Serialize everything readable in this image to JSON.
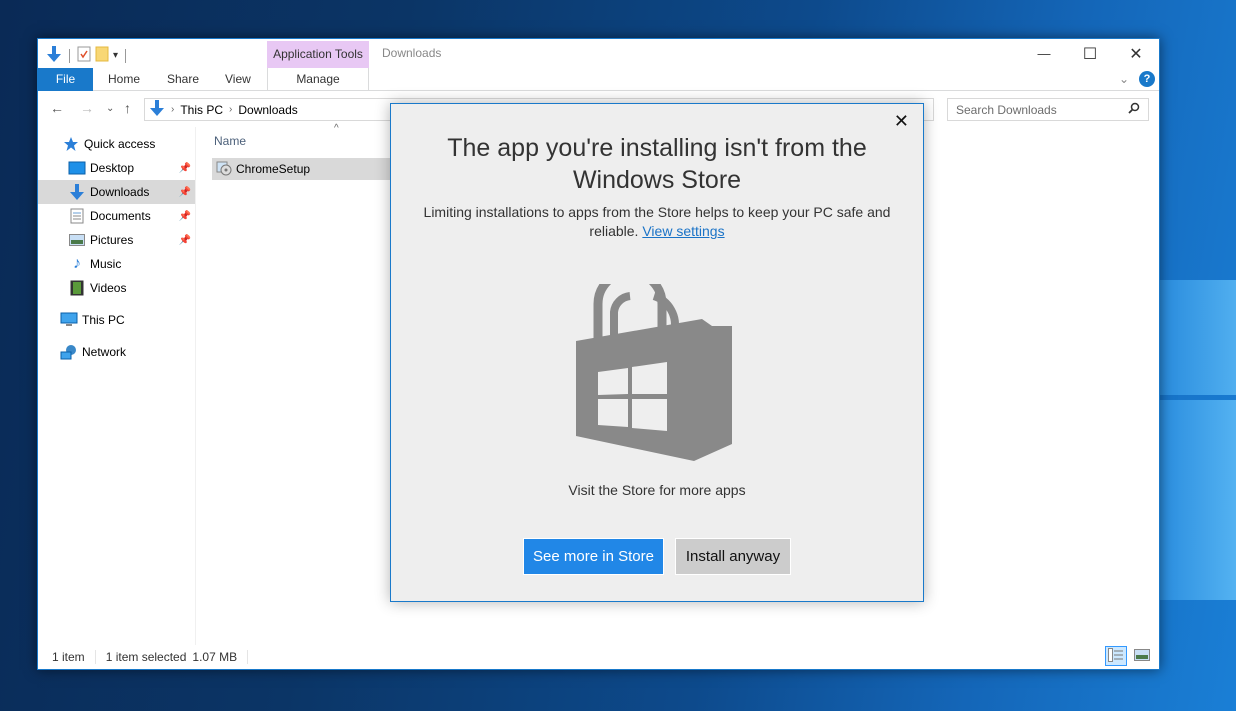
{
  "window": {
    "title": "Downloads",
    "context_tab": "Application Tools",
    "controls": {
      "minimize": "—",
      "maximize": "☐",
      "close": "✕"
    }
  },
  "ribbon": {
    "tabs": [
      {
        "label": "File"
      },
      {
        "label": "Home"
      },
      {
        "label": "Share"
      },
      {
        "label": "View"
      },
      {
        "label": "Manage"
      }
    ],
    "help": "?",
    "collapse": "⌄"
  },
  "navigation": {
    "back": "←",
    "forward": "→",
    "recent": "⌄",
    "up": "↑",
    "breadcrumb": [
      "This PC",
      "Downloads"
    ],
    "separator": "›",
    "search_placeholder": "Search Downloads"
  },
  "sidebar": {
    "items": [
      {
        "label": "Quick access",
        "icon": "star-icon"
      },
      {
        "label": "Desktop",
        "icon": "desktop-icon",
        "pinned": true
      },
      {
        "label": "Downloads",
        "icon": "download-icon",
        "pinned": true,
        "selected": true
      },
      {
        "label": "Documents",
        "icon": "documents-icon",
        "pinned": true
      },
      {
        "label": "Pictures",
        "icon": "pictures-icon",
        "pinned": true
      },
      {
        "label": "Music",
        "icon": "music-icon"
      },
      {
        "label": "Videos",
        "icon": "videos-icon"
      },
      {
        "label": "This PC",
        "icon": "computer-icon"
      },
      {
        "label": "Network",
        "icon": "network-icon"
      }
    ]
  },
  "filelist": {
    "column_name": "Name",
    "sort_indicator": "^",
    "files": [
      {
        "name": "ChromeSetup",
        "selected": true
      }
    ]
  },
  "statusbar": {
    "item_count": "1 item",
    "selection": "1 item selected",
    "size": "1.07 MB"
  },
  "dialog": {
    "title": "The app you're installing isn't from the Windows Store",
    "description": "Limiting installations to apps from the Store helps to keep your PC safe and reliable.",
    "link": "View settings",
    "visit_text": "Visit the Store for more apps",
    "primary_button": "See more in Store",
    "secondary_button": "Install anyway",
    "close": "✕",
    "accent_color": "#2187e7"
  }
}
